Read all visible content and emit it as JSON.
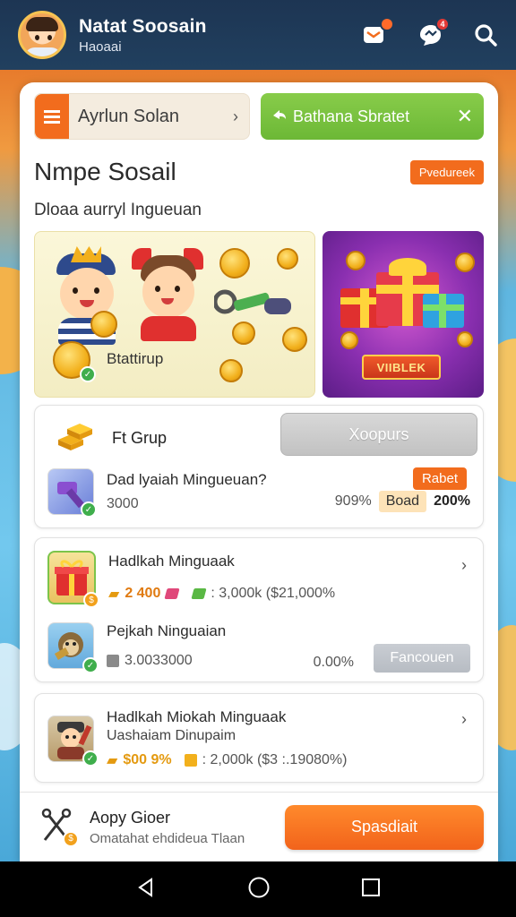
{
  "header": {
    "user_name": "Natat Soosain",
    "user_sub": "Haoaai",
    "notif_badge": "",
    "chat_badge": "4"
  },
  "tabs": {
    "left_label": "Ayrlun Solan",
    "right_label": "Bathana Sbratet"
  },
  "title": "Nmpe Sosail",
  "title_badge": "Pvedureek",
  "subtitle": "Dloaa aurryl Ingueuan",
  "promo": {
    "left_caption": "Btattirup",
    "right_banner": "VIIBLEK"
  },
  "group": {
    "name": "Ft Grup",
    "button": "Xoopurs",
    "item": {
      "title": "Dad lyaiah Mingueuan?",
      "badge": "Rabet",
      "value": "3000",
      "pct": "909%",
      "tag": "Boad",
      "bonus": "200%"
    }
  },
  "list2": {
    "item1": {
      "title": "Hadlkah Minguaak",
      "amount": "2 400",
      "stat": ": 3,000k ($21,000%"
    },
    "item2": {
      "title": "Pejkah Ninguaian",
      "value": "3.0033000",
      "pct": "0.00%",
      "button": "Fancouen"
    }
  },
  "list3": {
    "title": "Hadlkah Miokah Minguaak",
    "sub": "Uashaiam Dinupaim",
    "amount": "$00 9%",
    "stat": ": 2,000k ($3 :.19080%)"
  },
  "footer": {
    "title": "Aopy Gioer",
    "sub": "Omatahat ehdideua Tlaan",
    "cta": "Spasdiait"
  },
  "colors": {
    "accent_orange": "#f26c1d",
    "accent_green": "#6cb836",
    "header_navy": "#1f3a57"
  }
}
